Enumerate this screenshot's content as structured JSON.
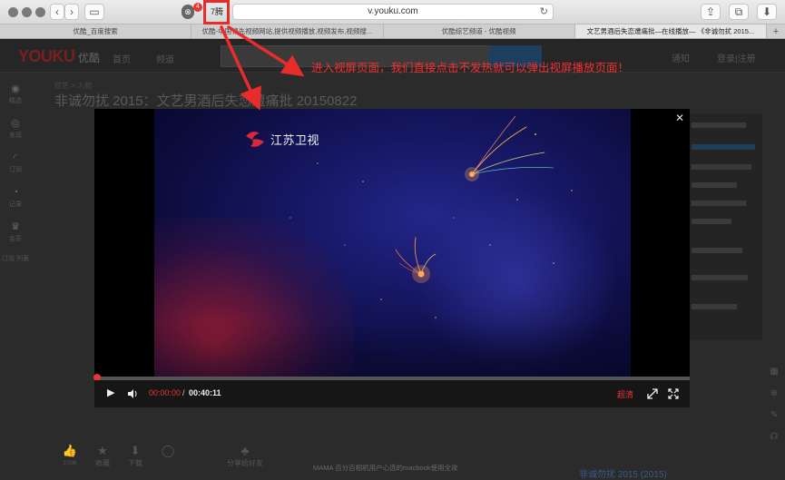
{
  "browser": {
    "url": "v.youku.com",
    "extension_badge": "4",
    "highlight_icon_label": "7腾"
  },
  "tabs": [
    {
      "label": "优酷_百度搜索"
    },
    {
      "label": "优酷-中国领先视频网站,提供视频播放,视频发布,视频搜..."
    },
    {
      "label": "优酷综艺频道 - 优酷视频"
    },
    {
      "label": "文艺男酒后失恋遭痛批—在线播放— 《非诚勿扰 2015..."
    }
  ],
  "page": {
    "logo": "YOUKU",
    "logo_cn": "优酷",
    "nav": [
      "首页",
      "频道"
    ],
    "header_right": [
      "通知",
      "登录|注册"
    ],
    "breadcrumb": "综艺 > 人物",
    "video_title": "非诚勿扰 2015：文艺男酒后失恋遭痛批 20150822",
    "sidebar": [
      {
        "icon": "home-icon",
        "label": "精选"
      },
      {
        "icon": "eye-icon",
        "label": "发现"
      },
      {
        "icon": "rss-icon",
        "label": "订阅"
      },
      {
        "icon": "clock-icon",
        "label": "记录"
      },
      {
        "icon": "crown-icon",
        "label": "会员"
      },
      {
        "icon": "app-icon",
        "label": "订阅 列表"
      }
    ],
    "bottom_actions": [
      {
        "icon": "thumb-up-icon",
        "label": "2,006"
      },
      {
        "icon": "star-icon",
        "label": "收藏"
      },
      {
        "icon": "download-icon",
        "label": "下载"
      },
      {
        "icon": "comment-icon",
        "label": ""
      },
      {
        "icon": "share-icon",
        "label": "分享给好友"
      }
    ],
    "episode_title": "非诚勿扰 2015 (2015)",
    "bottom_notice": "MAMA 百分百相机用户心选的macbook使用全攻"
  },
  "player": {
    "channel_name": "江苏卫视",
    "time_current": "00:00:00",
    "time_separator": "/",
    "time_total": "00:40:11",
    "quality": "超清",
    "progress": 0.0
  },
  "annotation": {
    "text": "进入视屏页面，我们直接点击不发热就可以弹出视屏播放页面！"
  },
  "colors": {
    "accent_red": "#e33333",
    "annotation_red": "#f03030"
  }
}
